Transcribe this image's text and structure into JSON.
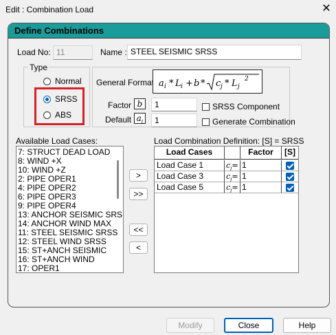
{
  "window": {
    "title": "Edit : Combination Load",
    "close_glyph": "✕"
  },
  "panel": {
    "title": "Define Combinations"
  },
  "load_no": {
    "label": "Load No:",
    "value": "11"
  },
  "name": {
    "label": "Name :",
    "value": "STEEL SEISMIC SRSS"
  },
  "type": {
    "label": "Type",
    "options": [
      "Normal",
      "SRSS",
      "ABS"
    ],
    "selected": "SRSS"
  },
  "general_format": {
    "label": "General Format :"
  },
  "factor": {
    "label": "Factor",
    "symbol": "b",
    "value": "1"
  },
  "default": {
    "label": "Default",
    "symbol": "a",
    "symbol_sub": "i",
    "value": "1"
  },
  "options": {
    "srss_component": "SRSS Component",
    "generate_combination": "Generate Combination"
  },
  "available": {
    "label": "Available Load Cases:",
    "items": [
      "7: STRUCT DEAD LOAD",
      "8: WIND +X",
      "10: WIND +Z",
      "2: PIPE OPER1",
      "4: PIPE OPER2",
      "6: PIPE OPER3",
      "9: PIPE OPER4",
      "13: ANCHOR SEISMIC SRS",
      "14: ANCHOR WIND MAX",
      "11: STEEL SEISMIC SRSS",
      "12: STEEL WIND SRSS",
      "15: ST+ANCH SEISMIC",
      "16: ST+ANCH WIND",
      "17: OPER1"
    ]
  },
  "transfer": {
    "add": ">",
    "add_all": ">>",
    "remove_all": "<<",
    "remove": "<"
  },
  "definition": {
    "label": "Load Combination Definition:  [S] = SRSS",
    "columns": [
      "Load Cases",
      "Factor",
      "[S]"
    ],
    "coef_symbol": "c",
    "coef_sub": "j",
    "rows": [
      {
        "case": "Load Case 1",
        "factor": "1",
        "srss": true
      },
      {
        "case": "Load Case 3",
        "factor": "1",
        "srss": true
      },
      {
        "case": "Load Case 5",
        "factor": "1",
        "srss": true
      }
    ]
  },
  "buttons": {
    "modify": "Modify",
    "close": "Close",
    "help": "Help"
  },
  "colors": {
    "header": "#1a9c9b",
    "highlight": "#d62027",
    "accent": "#005fb8"
  }
}
